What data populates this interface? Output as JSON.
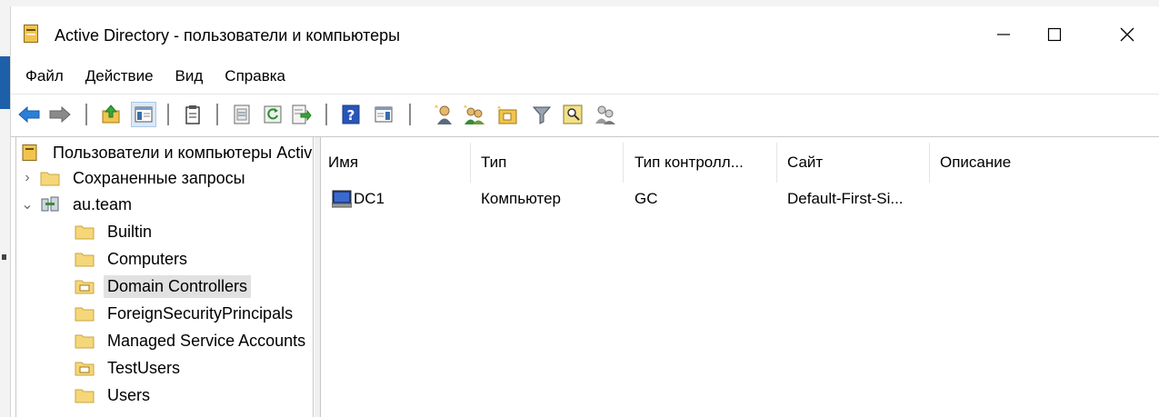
{
  "window": {
    "title": "Active Directory - пользователи и компьютеры"
  },
  "menu": [
    "Файл",
    "Действие",
    "Вид",
    "Справка"
  ],
  "toolbar_icons": [
    "back-arrow-icon",
    "forward-arrow-icon",
    "up-folder-icon",
    "show-hide-tree-icon",
    "clipboard-icon",
    "properties-icon",
    "refresh-icon",
    "export-list-icon",
    "help-icon",
    "action-pane-icon",
    "new-user-icon",
    "new-group-icon",
    "new-ou-icon",
    "filter-icon",
    "find-icon",
    "delegate-icon"
  ],
  "tree": {
    "root": "Пользователи и компьютеры Active Directory",
    "saved_queries": "Сохраненные запросы",
    "domain": "au.team",
    "children": [
      "Builtin",
      "Computers",
      "Domain Controllers",
      "ForeignSecurityPrincipals",
      "Managed Service Accounts",
      "TestUsers",
      "Users"
    ],
    "selected": "Domain Controllers"
  },
  "list": {
    "columns": [
      "Имя",
      "Тип",
      "Тип контролл...",
      "Сайт",
      "Описание"
    ],
    "rows": [
      {
        "name": "DC1",
        "type": "Компьютер",
        "dc_type": "GC",
        "site": "Default-First-Si...",
        "description": ""
      }
    ]
  },
  "colors": {
    "selection": "#e1e1e1",
    "toolbar_active": "#dbe9f6",
    "folder": "#f5d77a"
  }
}
